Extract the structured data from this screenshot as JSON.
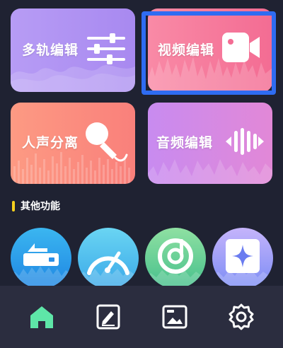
{
  "cards": {
    "multitrack": {
      "label": "多轨编辑",
      "icon": "equalizer-sliders-icon"
    },
    "video": {
      "label": "视频编辑",
      "icon": "video-camera-icon"
    },
    "vocal": {
      "label": "人声分离",
      "icon": "microphone-icon"
    },
    "audio": {
      "label": "音频编辑",
      "icon": "audio-waveform-icon"
    }
  },
  "section": {
    "title": "其他功能"
  },
  "tools": [
    {
      "icon": "drive-upload-icon"
    },
    {
      "icon": "speed-gauge-icon"
    },
    {
      "icon": "music-disc-icon"
    },
    {
      "icon": "sparkle-star-icon"
    }
  ],
  "bottom_nav": [
    {
      "icon": "home-icon",
      "active": true
    },
    {
      "icon": "edit-document-icon",
      "active": false
    },
    {
      "icon": "media-library-icon",
      "active": false
    },
    {
      "icon": "settings-gear-icon",
      "active": false
    }
  ],
  "colors": {
    "background": "#1f2232",
    "nav_background": "#2b2d3f",
    "highlight": "#2f6cf2",
    "accent_yellow": "#f5d01e",
    "home_active": "#5ee6a8"
  }
}
